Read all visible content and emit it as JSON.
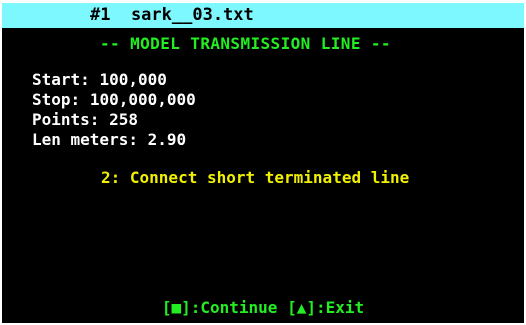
{
  "window": {
    "title": "#1  sark__03.txt"
  },
  "screen": {
    "subtitle": "-- MODEL TRANSMISSION LINE --",
    "fields": {
      "start_label": "Start:",
      "start_value": "100,000",
      "stop_label": "Stop:",
      "stop_value": "100,000,000",
      "points_label": "Points:",
      "points_value": "258",
      "len_label": "Len meters:",
      "len_value": "2.90"
    },
    "instruction": "2: Connect short terminated line"
  },
  "footer": {
    "continue_key": "[■]:Continue",
    "exit_key": "[▲]:Exit"
  },
  "colors": {
    "title_bar": "#7ef8ff",
    "background": "#000000",
    "heading": "#22ee22",
    "info_text": "#ffffff",
    "instruction": "#f0f000"
  }
}
